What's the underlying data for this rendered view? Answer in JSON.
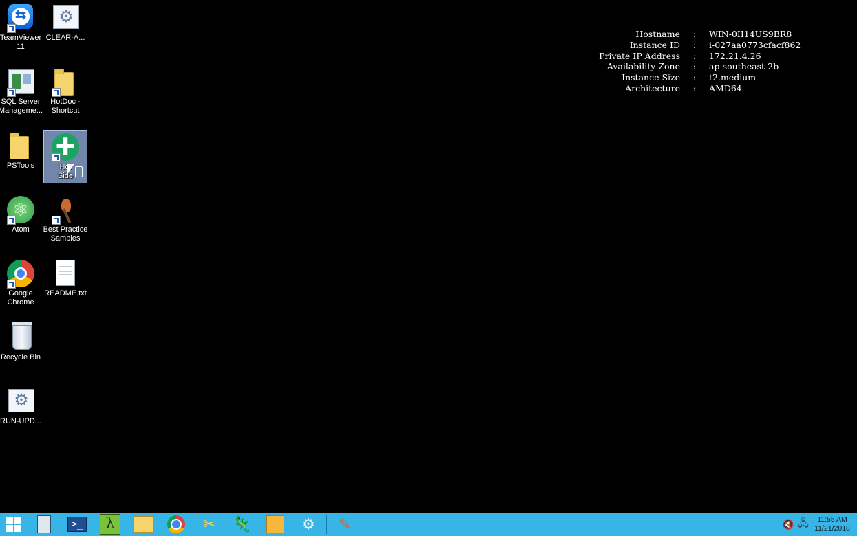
{
  "desktop": {
    "icons": [
      {
        "id": "teamviewer",
        "label": "TeamViewer 11",
        "icon": "teamviewer-icon"
      },
      {
        "id": "clear",
        "label": "CLEAR-A...",
        "icon": "gear-script-icon"
      },
      {
        "id": "sqlserver",
        "label": "SQL Server Manageme...",
        "icon": "sql-server-icon"
      },
      {
        "id": "hotdoc-shortcut",
        "label": "HotDoc - Shortcut",
        "icon": "folder-icon"
      },
      {
        "id": "pstools",
        "label": "PSTools",
        "icon": "folder-icon"
      },
      {
        "id": "hotdoc-sidebar",
        "label": "HotDoc Sidebar",
        "icon": "green-plus-icon"
      },
      {
        "id": "atom",
        "label": "Atom",
        "icon": "atom-icon"
      },
      {
        "id": "bestpractice",
        "label": "Best Practice Samples",
        "icon": "bird-icon"
      },
      {
        "id": "chrome",
        "label": "Google Chrome",
        "icon": "chrome-icon"
      },
      {
        "id": "readme",
        "label": "README.txt",
        "icon": "text-file-icon"
      },
      {
        "id": "recyclebin",
        "label": "Recycle Bin",
        "icon": "recycle-bin-icon"
      },
      {
        "id": "runupd",
        "label": "RUN-UPD...",
        "icon": "gear-script-icon"
      }
    ],
    "selected_icon": "hotdoc-sidebar",
    "visible_selected_label": "Hot\nSide"
  },
  "instance_info": {
    "rows": [
      {
        "key": "Hostname",
        "sep": ":",
        "value": "WIN-0II14US9BR8"
      },
      {
        "key": "Instance ID",
        "sep": ":",
        "value": "i-027aa0773cfacf862"
      },
      {
        "key": "Private IP Address",
        "sep": ":",
        "value": "172.21.4.26"
      },
      {
        "key": "Availability Zone",
        "sep": ":",
        "value": "ap-southeast-2b"
      },
      {
        "key": "Instance Size",
        "sep": ":",
        "value": "t2.medium"
      },
      {
        "key": "Architecture",
        "sep": ":",
        "value": "AMD64"
      }
    ]
  },
  "taskbar": {
    "background": "#37b5e6",
    "items": [
      "start-icon",
      "server-manager-icon",
      "powershell-icon",
      "lambda-icon",
      "file-explorer-icon",
      "chrome-icon",
      "snipping-tool-icon",
      "notepad-plus-icon",
      "package-icon",
      "gear-icon",
      "bird-icon"
    ],
    "tray": {
      "icons": [
        "volume-muted-icon",
        "network-icon"
      ],
      "time": "11:55 AM",
      "date": "11/21/2018"
    }
  }
}
